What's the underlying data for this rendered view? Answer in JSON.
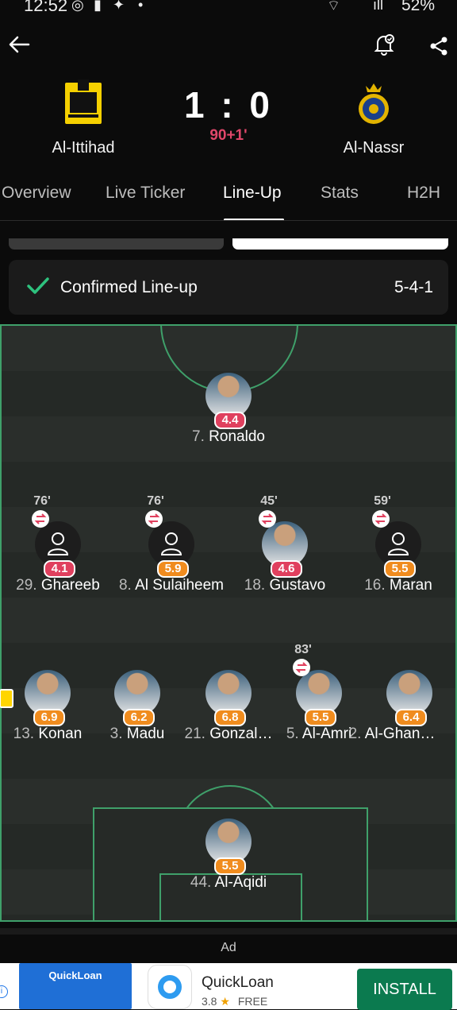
{
  "status_bar": {
    "time": "12:52",
    "right": "52%"
  },
  "match": {
    "home_team": "Al-Ittihad",
    "away_team": "Al-Nassr",
    "score": "1 : 0",
    "time": "90+1'"
  },
  "tabs": [
    "Overview",
    "Live Ticker",
    "Line-Up",
    "Stats",
    "H2H"
  ],
  "lineup": {
    "status": "Confirmed Line-up",
    "formation": "5-4-1"
  },
  "players": {
    "ronaldo": {
      "num": "7.",
      "name": "Ronaldo",
      "rating": "4.4"
    },
    "ghareeb": {
      "num": "29.",
      "name": "Ghareeb",
      "rating": "4.1",
      "sub": "76'"
    },
    "sulaiheem": {
      "num": "8.",
      "name": "Al Sulaiheem",
      "rating": "5.9",
      "sub": "76'"
    },
    "gustavo": {
      "num": "18.",
      "name": "Gustavo",
      "rating": "4.6",
      "sub": "45'"
    },
    "maran": {
      "num": "16.",
      "name": "Maran",
      "rating": "5.5",
      "sub": "59'"
    },
    "konan": {
      "num": "13.",
      "name": "Konan",
      "rating": "6.9"
    },
    "madu": {
      "num": "3.",
      "name": "Madu",
      "rating": "6.2"
    },
    "gonzal": {
      "num": "21.",
      "name": "Gonzal…",
      "rating": "6.8"
    },
    "alamri": {
      "num": "5.",
      "name": "Al-Amri",
      "rating": "5.5",
      "sub": "83'"
    },
    "alghan": {
      "num": "2.",
      "name": "Al-Ghan…",
      "rating": "6.4"
    },
    "alaqidi": {
      "num": "44.",
      "name": "Al-Aqidi",
      "rating": "5.5"
    }
  },
  "ad": {
    "label": "Ad",
    "app_name": "QuickLoan",
    "rating": "3.8",
    "star": "★",
    "price": "FREE",
    "install": "INSTALL",
    "thumb_text": "QuickLoan"
  },
  "colors": {
    "pitch_line": "#3fa06a",
    "rating_red": "#e0405e",
    "rating_orange": "#f08c1e",
    "tab_active": "#ffffff"
  }
}
